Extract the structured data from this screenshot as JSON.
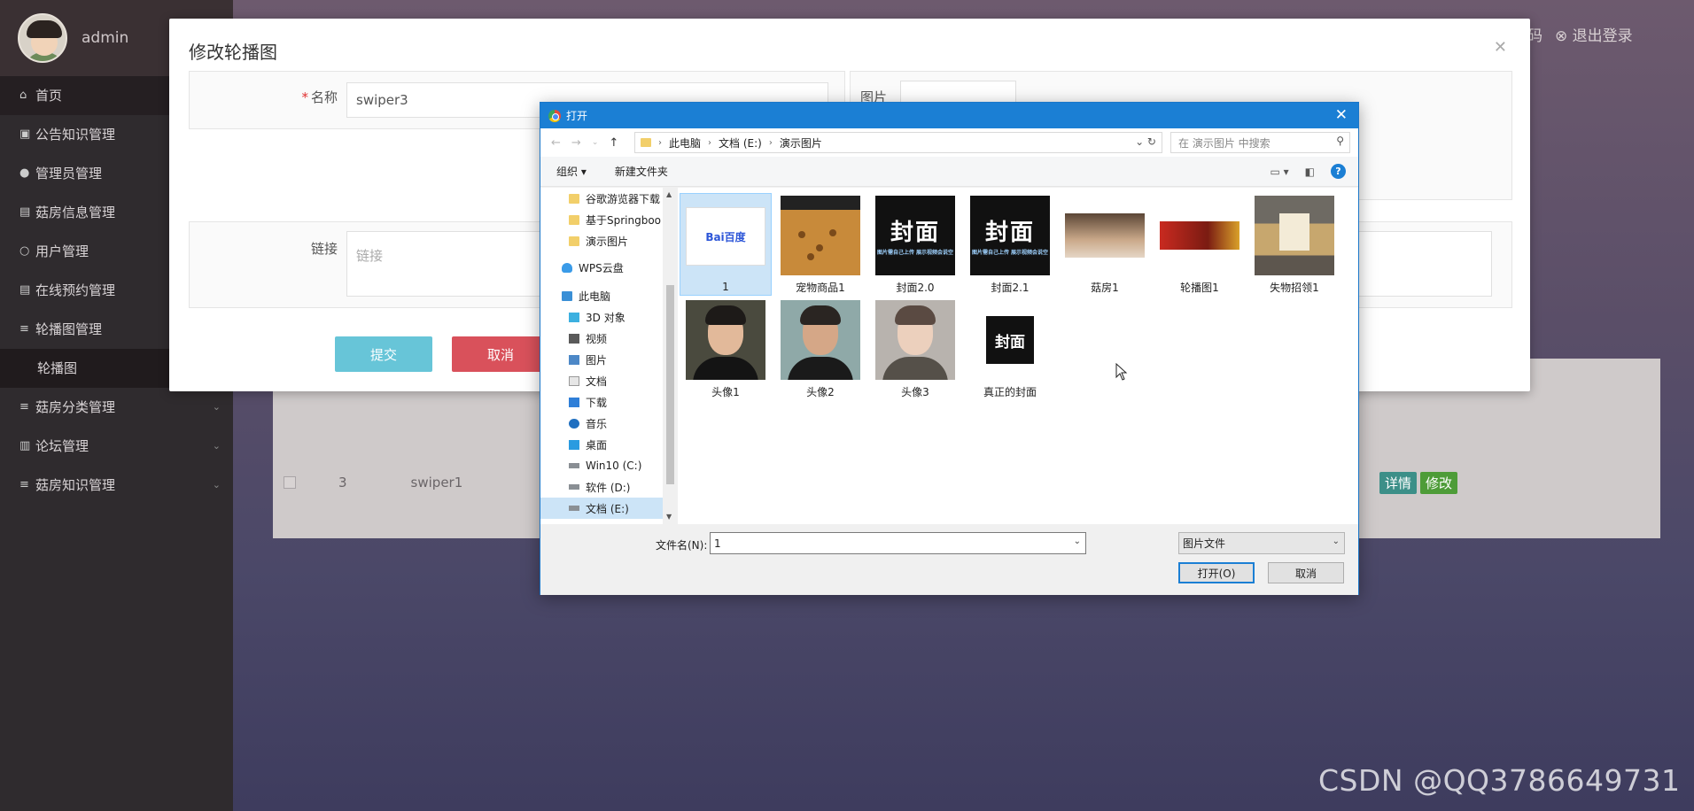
{
  "sidebar": {
    "username": "admin",
    "items": [
      {
        "label": "首页",
        "icon": "home-icon"
      },
      {
        "label": "公告知识管理",
        "icon": "bag-icon"
      },
      {
        "label": "管理员管理",
        "icon": "person-icon"
      },
      {
        "label": "菇房信息管理",
        "icon": "building-icon"
      },
      {
        "label": "用户管理",
        "icon": "person-outline-icon"
      },
      {
        "label": "在线预约管理",
        "icon": "building-icon"
      },
      {
        "label": "轮播图管理",
        "icon": "list-icon"
      },
      {
        "label": "轮播图",
        "icon": ""
      },
      {
        "label": "菇房分类管理",
        "icon": "list-icon"
      },
      {
        "label": "论坛管理",
        "icon": "columns-icon"
      },
      {
        "label": "菇房知识管理",
        "icon": "list-icon"
      }
    ]
  },
  "header": {
    "change_password": "改密码",
    "logout": "退出登录"
  },
  "content_row": {
    "index": "3",
    "name": "swiper1",
    "detail": "详情",
    "edit": "修改"
  },
  "modal": {
    "title": "修改轮播图",
    "name_label": "名称",
    "name_value": "swiper3",
    "image_label": "图片",
    "link_label": "链接",
    "link_placeholder": "链接",
    "submit": "提交",
    "cancel": "取消"
  },
  "dialog": {
    "title": "打开",
    "path": [
      "此电脑",
      "文档 (E:)",
      "演示图片"
    ],
    "search_placeholder": "在 演示图片 中搜索",
    "organize": "组织 ▾",
    "new_folder": "新建文件夹",
    "nav": [
      {
        "label": "谷歌游览器下载",
        "icon": "folder"
      },
      {
        "label": "基于Springboo",
        "icon": "folder"
      },
      {
        "label": "演示图片",
        "icon": "folder"
      },
      {
        "label": "WPS云盘",
        "icon": "cloud"
      },
      {
        "label": "此电脑",
        "icon": "pc"
      },
      {
        "label": "3D 对象",
        "icon": "cube"
      },
      {
        "label": "视频",
        "icon": "video"
      },
      {
        "label": "图片",
        "icon": "pic"
      },
      {
        "label": "文档",
        "icon": "doc"
      },
      {
        "label": "下载",
        "icon": "down"
      },
      {
        "label": "音乐",
        "icon": "music"
      },
      {
        "label": "桌面",
        "icon": "desk"
      },
      {
        "label": "Win10 (C:)",
        "icon": "drive"
      },
      {
        "label": "软件 (D:)",
        "icon": "drive"
      },
      {
        "label": "文档 (E:)",
        "icon": "drive"
      }
    ],
    "files": [
      {
        "name": "1",
        "thumb": "baidu"
      },
      {
        "name": "宠物商品1",
        "thumb": "pet"
      },
      {
        "name": "封面2.0",
        "thumb": "cover"
      },
      {
        "name": "封面2.1",
        "thumb": "cover"
      },
      {
        "name": "菇房1",
        "thumb": "mush"
      },
      {
        "name": "轮播图1",
        "thumb": "swiper"
      },
      {
        "name": "失物招领1",
        "thumb": "lost"
      },
      {
        "name": "头像1",
        "thumb": "face1"
      },
      {
        "name": "头像2",
        "thumb": "face2"
      },
      {
        "name": "头像3",
        "thumb": "face3"
      },
      {
        "name": "真正的封面",
        "thumb": "real"
      }
    ],
    "thumb_text": {
      "baidu": "Bai百度",
      "cover_big": "封面",
      "cover_small": "图片需自己上传 展示视频会说空",
      "real": "封面"
    },
    "filename_label": "文件名(N):",
    "filename_value": "1",
    "filetype": "图片文件",
    "open_button": "打开(O)",
    "cancel_button": "取消"
  },
  "watermark": "CSDN @QQ3786649731"
}
